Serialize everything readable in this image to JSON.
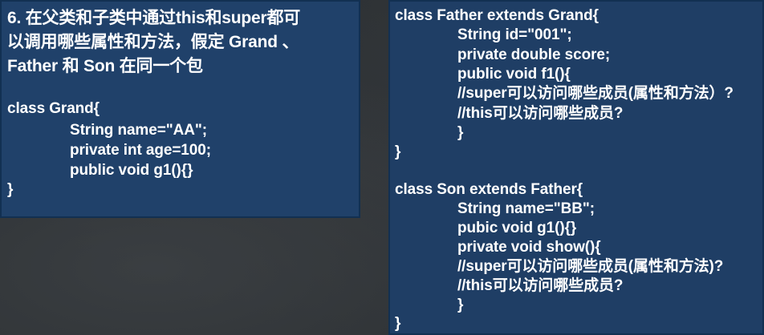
{
  "question": {
    "line1": "6. 在父类和子类中通过this和super都可",
    "line2": "以调用哪些属性和方法，假定 Grand 、",
    "line3": "Father 和 Son 在同一个包"
  },
  "grand_class": [
    "class Grand{",
    "String name=\"AA\";",
    "private int age=100;",
    "public void g1(){}",
    "}"
  ],
  "father_class": [
    "class Father extends Grand{",
    "String id=\"001\";",
    "private double score;",
    "public void f1(){",
    "//super可以访问哪些成员(属性和方法）?",
    "//this可以访问哪些成员?",
    "}",
    "}"
  ],
  "son_class": [
    "class Son extends Father{",
    "String name=\"BB\";",
    "pubic void g1(){}",
    "private void show(){",
    "//super可以访问哪些成员(属性和方法)?",
    "//this可以访问哪些成员?",
    "}",
    "}"
  ]
}
